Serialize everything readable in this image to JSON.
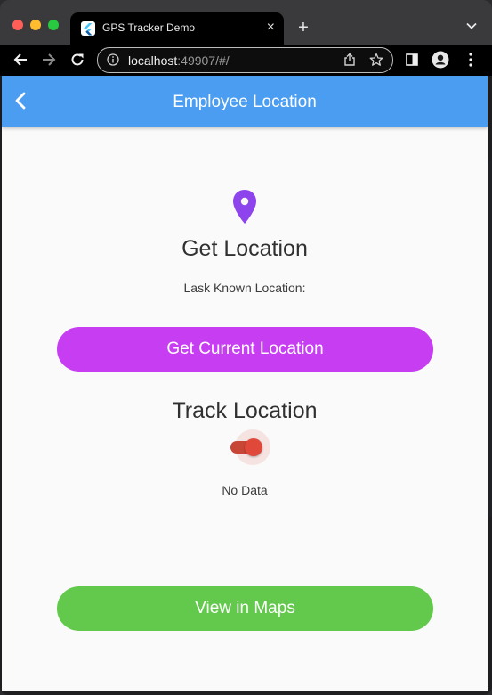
{
  "browser": {
    "tab_title": "GPS Tracker Demo",
    "tab_close": "×",
    "new_tab": "+",
    "url_host": "localhost",
    "url_rest": ":49907/#/"
  },
  "appbar": {
    "title": "Employee Location",
    "back_icon": "chevron-left-icon"
  },
  "get_location": {
    "icon": "location-pin-icon",
    "heading": "Get Location",
    "last_known": "Lask Known Location:",
    "button_label": "Get Current Location"
  },
  "track_location": {
    "heading": "Track Location",
    "switch_on": true,
    "status": "No Data"
  },
  "maps": {
    "button_label": "View in Maps"
  },
  "colors": {
    "appbar": "#4a9df0",
    "pin": "#8e44ec",
    "current_button": "#c73ef2",
    "maps_button": "#62c94c",
    "switch": "#e0483a"
  }
}
